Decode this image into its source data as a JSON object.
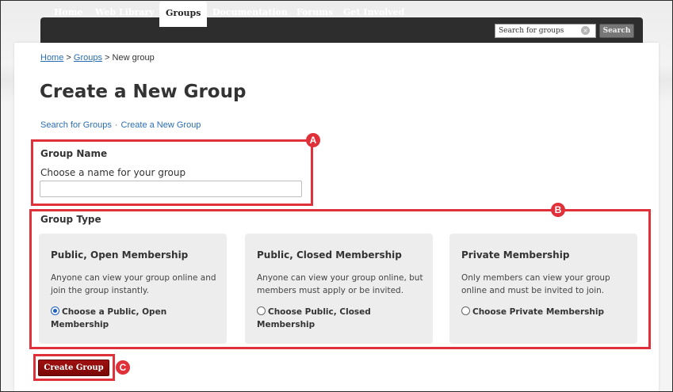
{
  "nav": {
    "items": [
      {
        "label": "Home"
      },
      {
        "label": "Web Library"
      },
      {
        "label": "Groups",
        "active": true
      },
      {
        "label": "Documentation"
      },
      {
        "label": "Forums"
      },
      {
        "label": "Get Involved"
      }
    ],
    "search_value": "Search for groups",
    "clear_icon": "×",
    "search_label": "Search"
  },
  "breadcrumb": {
    "home": "Home",
    "sep1": " > ",
    "groups": "Groups",
    "sep2": " > ",
    "current": "New group"
  },
  "page_title": "Create a New Group",
  "subnav": {
    "search_link": "Search for Groups",
    "separator": "·",
    "create_link": "Create a New Group"
  },
  "group_name": {
    "heading": "Group Name",
    "label": "Choose a name for your group",
    "value": ""
  },
  "group_type": {
    "heading": "Group Type",
    "options": [
      {
        "title": "Public, Open Membership",
        "description": "Anyone can view your group online and join the group instantly.",
        "radio_label": "Choose a Public, Open Membership",
        "checked": true
      },
      {
        "title": "Public, Closed Membership",
        "description": "Anyone can view your group online, but members must apply or be invited.",
        "radio_label": "Choose Public, Closed Membership",
        "checked": false
      },
      {
        "title": "Private Membership",
        "description": "Only members can view your group online and must be invited to join.",
        "radio_label": "Choose Private Membership",
        "checked": false
      }
    ]
  },
  "create_button_label": "Create Group",
  "callouts": {
    "a": "A",
    "b": "B",
    "c": "C"
  },
  "colors": {
    "accent_red": "#e0303a",
    "button_red": "#8b0a0a",
    "link_blue": "#2a6eb5",
    "nav_dark": "#2d2d2d"
  }
}
